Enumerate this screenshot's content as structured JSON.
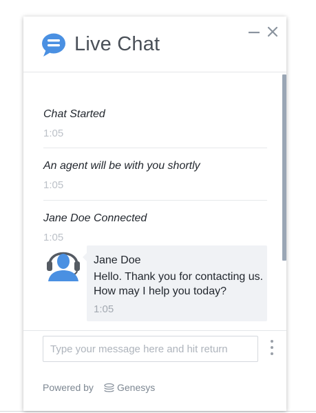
{
  "header": {
    "title": "Live Chat",
    "logo_icon": "chat-bubble-icon",
    "minimize_icon": "minimize-icon",
    "close_icon": "close-icon",
    "accent_color": "#4a90e2"
  },
  "messages": {
    "system": [
      {
        "text": "Chat Started",
        "time": "1:05"
      },
      {
        "text": "An agent will be with you shortly",
        "time": "1:05"
      },
      {
        "text": "Jane Doe Connected",
        "time": "1:05"
      }
    ],
    "agent": {
      "name": "Jane Doe",
      "text": "Hello. Thank you for contacting us. How may I help you today?",
      "time": "1:05",
      "avatar_icon": "agent-headset-avatar-icon"
    }
  },
  "composer": {
    "placeholder": "Type your message here and hit return",
    "value": "",
    "more_icon": "more-vertical-icon"
  },
  "footer": {
    "powered_by": "Powered by",
    "brand": "Genesys",
    "brand_icon": "genesys-logo-icon"
  }
}
